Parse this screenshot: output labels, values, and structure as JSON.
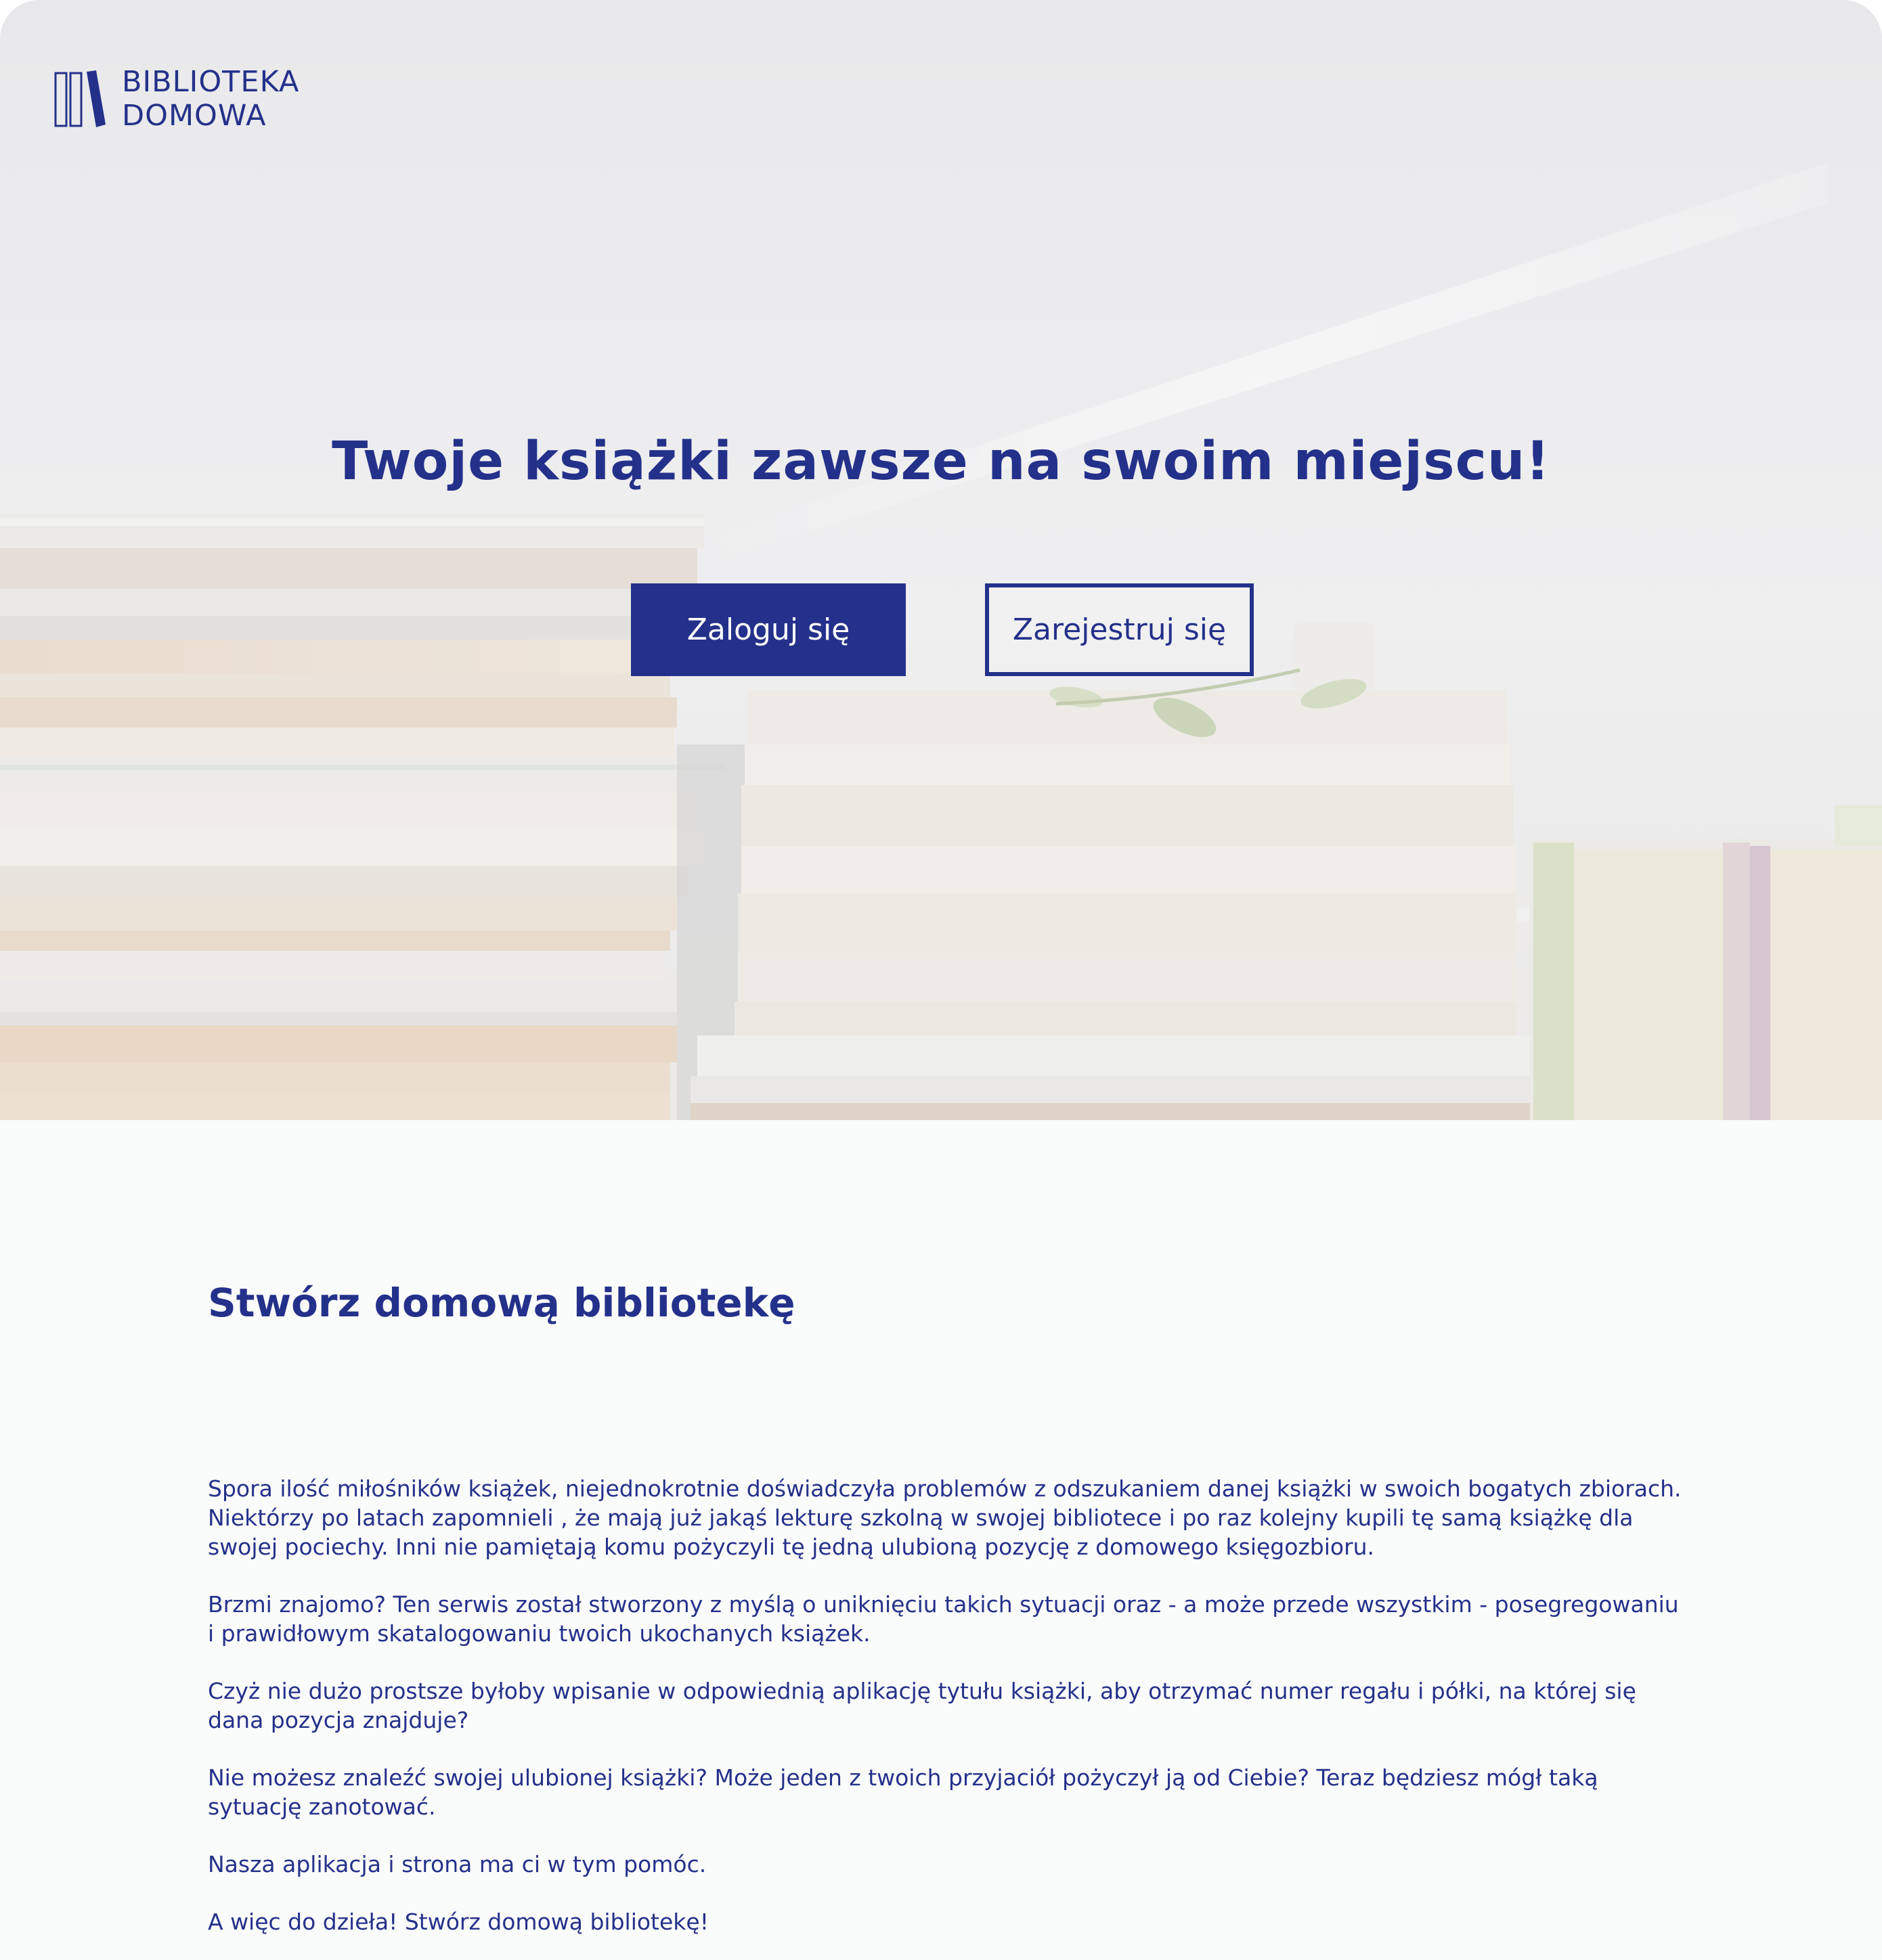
{
  "brand": {
    "line1": "BIBLIOTEKA",
    "line2": "DOMOWA",
    "icon": "books-icon",
    "color": "#24318a"
  },
  "hero": {
    "title": "Twoje książki zawsze na swoim miejscu!",
    "login_label": "Zaloguj się",
    "register_label": "Zarejestruj się",
    "image": "books-stack-image"
  },
  "about": {
    "title": "Stwórz domową bibliotekę",
    "paragraphs": [
      "Spora ilość miłośników książek, niejednokrotnie doświadczyła problemów z odszukaniem danej książki w swoich bogatych zbiorach. Niektórzy po latach zapomnieli , że mają już jakąś lekturę szkolną w swojej bibliotece i po raz kolejny kupili tę samą książkę dla swojej pociechy. Inni nie pamiętają komu pożyczyli tę jedną ulubioną pozycję z domowego księgozbioru.",
      "Brzmi znajomo? Ten serwis został stworzony z myślą o uniknięciu takich sytuacji oraz - a może przede wszystkim - posegregowaniu i prawidłowym skatalogowaniu twoich ukochanych książek.",
      "Czyż nie dużo prostsze byłoby wpisanie w odpowiednią aplikację tytułu książki, aby otrzymać numer regału i półki, na której się dana pozycja znajduje?",
      "Nie możesz znaleźć swojej ulubionej książki? Może jeden z twoich przyjaciół pożyczył ją od Ciebie? Teraz będziesz mógł taką sytuację zanotować.",
      "Nasza aplikacja i strona ma ci w tym pomóc.",
      "A więc do dzieła! Stwórz domową bibliotekę!"
    ]
  }
}
